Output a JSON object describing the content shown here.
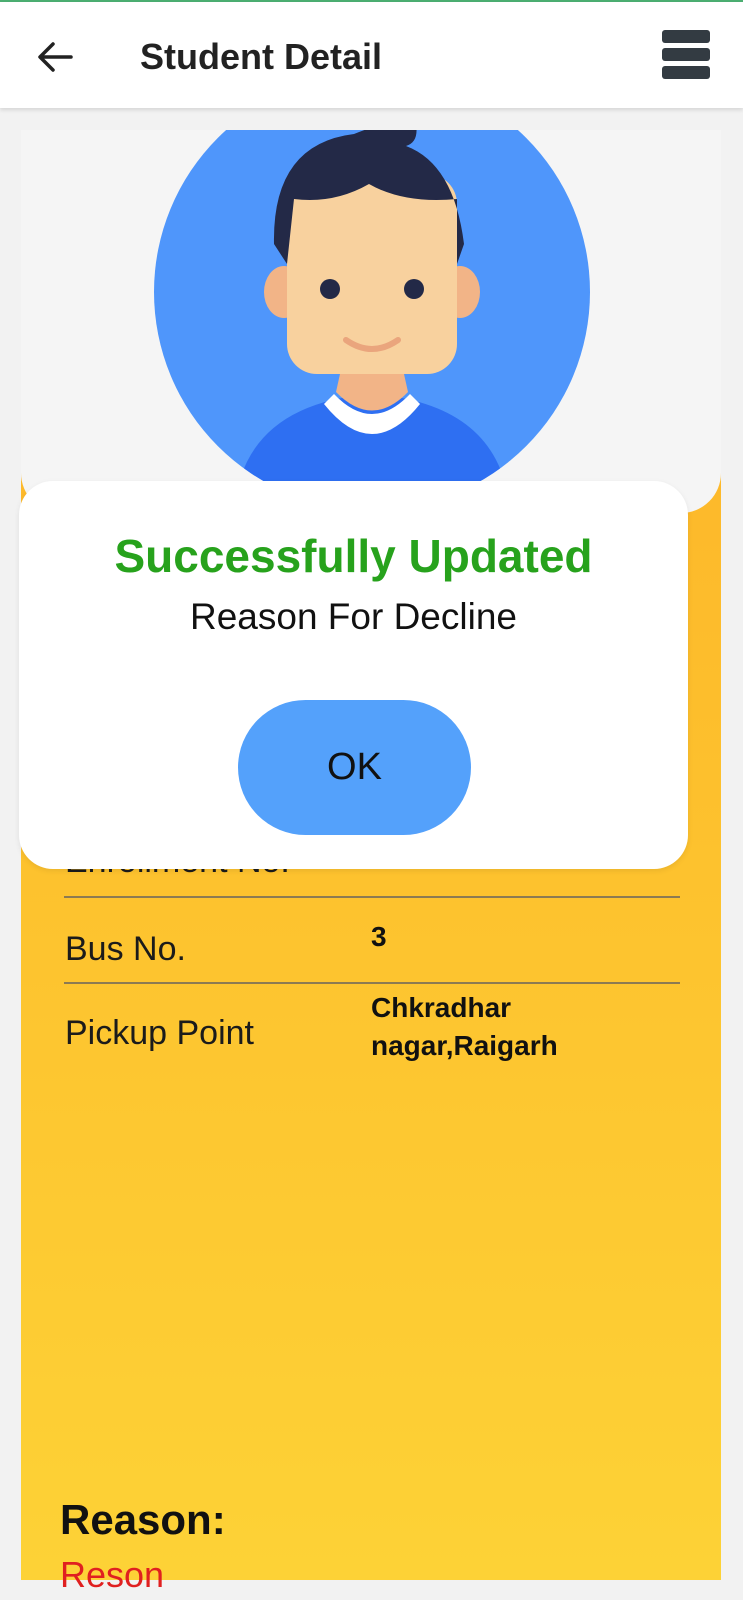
{
  "appbar": {
    "title": "Student Detail",
    "back_icon": "arrow-left-icon",
    "menu_icon": "menu-icon"
  },
  "student": {
    "avatar_icon": "student-avatar",
    "fields": [
      {
        "label": "Enrollment No.",
        "value": ""
      },
      {
        "label": "Bus No.",
        "value": "3"
      },
      {
        "label": "Pickup Point",
        "value": "Chkradhar nagar,Raigarh"
      }
    ],
    "reason_label": "Reason:",
    "reason_value": "Reson"
  },
  "dialog": {
    "title": "Successfully Updated",
    "message": "Reason For Decline",
    "ok_label": "OK"
  },
  "colors": {
    "success": "#27a21c",
    "ok_button": "#54a1fb",
    "card_gradient_top": "#fdb128",
    "card_gradient_bottom": "#fdd236",
    "reason_value": "#e02020"
  }
}
